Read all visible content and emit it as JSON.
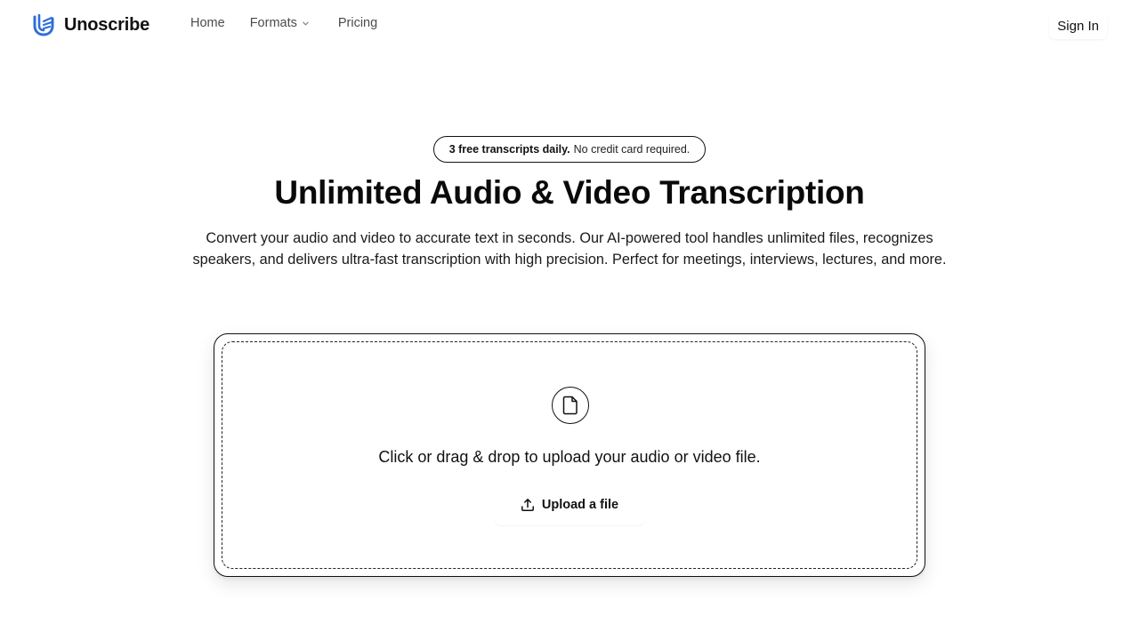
{
  "header": {
    "brand_name": "Unoscribe",
    "nav": {
      "home": "Home",
      "formats": "Formats",
      "pricing": "Pricing"
    },
    "sign_in": "Sign In"
  },
  "hero": {
    "badge_strong": "3 free transcripts daily.",
    "badge_rest": "No credit card required.",
    "title": "Unlimited Audio & Video Transcription",
    "subtitle": "Convert your audio and video to accurate text in seconds. Our AI-powered tool handles unlimited files, recognizes speakers, and delivers ultra-fast transcription with high precision. Perfect for meetings, interviews, lectures, and more."
  },
  "upload": {
    "prompt": "Click or drag & drop to upload your audio or video file.",
    "button_label": "Upload a file"
  },
  "icons": {
    "logo": "unoscribe-logo",
    "formats_chevron": "chevron-down-icon",
    "file": "file-icon",
    "upload": "upload-icon"
  },
  "colors": {
    "brand_blue": "#2f6fd6",
    "text": "#111111",
    "nav_text": "#4b4b4b"
  }
}
